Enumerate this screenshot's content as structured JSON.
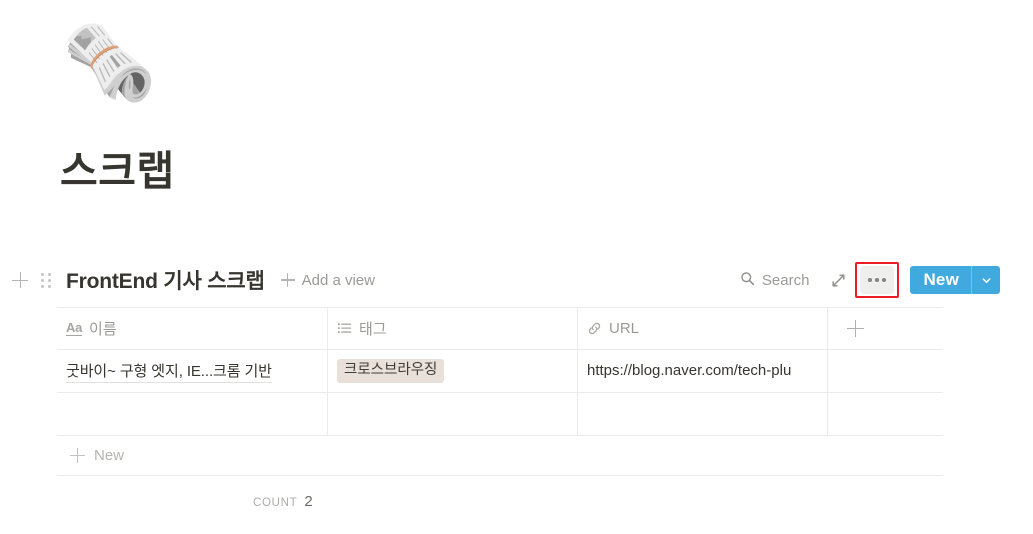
{
  "page": {
    "icon": "🗞️",
    "icon_name": "rolled-newspaper-emoji",
    "title": "스크랩"
  },
  "collection_toolbar": {
    "view_name": "FrontEnd 기사 스크랩",
    "add_view_label": "Add a view",
    "search_label": "Search",
    "new_button_label": "New",
    "more_options_label": "•••",
    "highlight_color": "#ed1c24",
    "accent_color": "#40a9dd",
    "more_button_bg": "#efefee"
  },
  "table": {
    "columns": [
      {
        "label": "이름",
        "type_icon": "title-aa-icon"
      },
      {
        "label": "태그",
        "type_icon": "multi-select-list-icon"
      },
      {
        "label": "URL",
        "type_icon": "link-icon"
      }
    ],
    "add_column_label": "+",
    "rows": [
      {
        "name": "굿바이~ 구형 엣지, IE...크롬 기반",
        "tag": "크로스브라우징",
        "tag_color": "#eae0da",
        "url": "https://blog.naver.com/tech-plu"
      },
      {
        "name": "",
        "tag": "",
        "url": ""
      }
    ],
    "new_row_label": "New",
    "count_label": "COUNT",
    "count_value": "2"
  }
}
